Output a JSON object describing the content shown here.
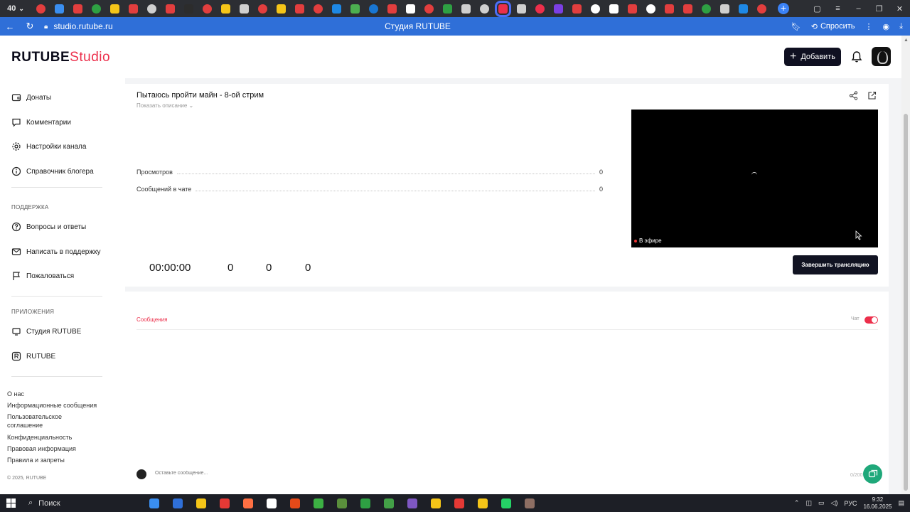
{
  "browser": {
    "tab_counter": "40",
    "url": "studio.rutube.ru",
    "page_title": "Студия RUTUBE",
    "ask_label": "Спросить",
    "tab_icon_colors": [
      "#e23e3e",
      "#3a8ef0",
      "#e23e3e",
      "#2ea043",
      "#f5c518",
      "#e23e3e",
      "#cfcfcf",
      "#e23e3e",
      "#2c2c2c",
      "#e23e3e",
      "#f5c518",
      "#cfcfcf",
      "#e23e3e",
      "#f5c518",
      "#e23e3e",
      "#e23e3e",
      "#1e88e5",
      "#4caf50",
      "#1976d2",
      "#e23e3e",
      "#ffffff",
      "#e23e3e",
      "#2ea043",
      "#cfcfcf",
      "#cfcfcf",
      "#ec2f4b",
      "#cfcfcf",
      "#ec2f4b",
      "#7b3fe4",
      "#e23e3e",
      "#ffffff",
      "#ffffff",
      "#e23e3e",
      "#ffffff",
      "#e23e3e",
      "#e23e3e",
      "#2ea043",
      "#cfcfcf",
      "#1e88e5",
      "#e23e3e"
    ]
  },
  "header": {
    "logo_main": "RUTUBE",
    "logo_sub": "Studio",
    "add_label": "Добавить"
  },
  "sidebar": {
    "items_top": [
      {
        "label": "Донаты",
        "icon": "wallet-icon"
      },
      {
        "label": "Комментарии",
        "icon": "comment-icon"
      },
      {
        "label": "Настройки канала",
        "icon": "gear-icon"
      },
      {
        "label": "Справочник блогера",
        "icon": "info-icon"
      }
    ],
    "support_title": "ПОДДЕРЖКА",
    "support_items": [
      {
        "label": "Вопросы и ответы",
        "icon": "question-icon"
      },
      {
        "label": "Написать в поддержку",
        "icon": "mail-icon"
      },
      {
        "label": "Пожаловаться",
        "icon": "flag-icon"
      }
    ],
    "apps_title": "ПРИЛОЖЕНИЯ",
    "apps_items": [
      {
        "label": "Студия RUTUBE",
        "icon": "studio-app-icon"
      },
      {
        "label": "RUTUBE",
        "icon": "rutube-app-icon"
      }
    ],
    "footer_links": [
      "О нас",
      "Информационные сообщения",
      "Пользовательское соглашение",
      "Конфиденциальность",
      "Правовая информация",
      "Правила и запреты"
    ],
    "copyright": "© 2025, RUTUBE"
  },
  "stream": {
    "title": "Пытаюсь пройти майн - 8-ой стрим",
    "show_description": "Показать описание",
    "stats": [
      {
        "label": "Просмотров",
        "value": "0"
      },
      {
        "label": "Сообщений в чате",
        "value": "0"
      }
    ],
    "live_label": "В эфире",
    "timer": "00:00:00",
    "counters": [
      "0",
      "0",
      "0"
    ],
    "end_button": "Завершить трансляцию"
  },
  "chat": {
    "tab_label": "Сообщения",
    "toggle_label": "Чат",
    "toggle_on": true,
    "input_placeholder": "Оставьте сообщение...",
    "char_count": "0/200"
  },
  "taskbar": {
    "search_label": "Поиск",
    "app_colors": [
      "#3a8ef0",
      "#2f6fd8",
      "#f5c518",
      "#e53935",
      "#ff7043",
      "#ffffff",
      "#e64a19",
      "#3cb043",
      "#5a8f3c",
      "#2ea043",
      "#43a047",
      "#7e57c2",
      "#f5c518",
      "#e53935",
      "#f5c518",
      "#25d366",
      "#8d6e63"
    ],
    "lang": "РУС",
    "time": "9:32",
    "date": "16.06.2025"
  }
}
